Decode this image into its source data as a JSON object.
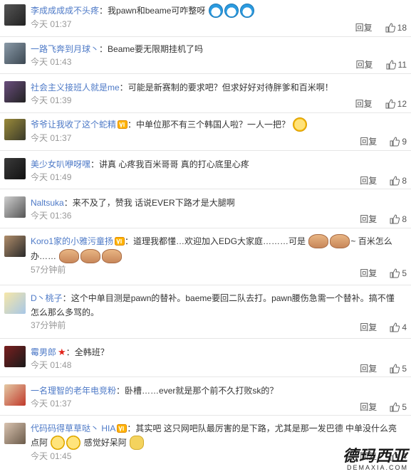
{
  "labels": {
    "reply": "回复"
  },
  "colors": {
    "username": "#4e7ac7",
    "time": "#999999",
    "divider": "#e6e6e6"
  },
  "comments": [
    {
      "user": "李成成成成不头疼",
      "sep": "：",
      "text": "我pawn和beame可咋整呀",
      "time": "今天 01:37",
      "likes": "18",
      "emojis": [
        "doraemon",
        "doraemon",
        "doraemon"
      ]
    },
    {
      "user": "一路飞奔到月球丶",
      "sep": "：",
      "text": "Beame要无限期挂机了吗",
      "time": "今天 01:43",
      "likes": "11"
    },
    {
      "user": "社会主义接班人就是me",
      "sep": "：",
      "text": "可能是新赛制的要求吧？但求好好对待胖爹和百米啊！",
      "time": "今天 01:39",
      "likes": "12"
    },
    {
      "user": "爷爷让我收了这个蛇精",
      "sep": "：",
      "text": "中单位那不有三个韩国人啦？一人一把？",
      "time": "今天 01:37",
      "likes": "9",
      "badge": "vip",
      "emojis": [
        "shock"
      ]
    },
    {
      "user": "美少女叭咿呀嘿",
      "sep": "：",
      "text": "讲真 心疼我百米哥哥 真的打心底里心疼",
      "time": "今天 01:49",
      "likes": "8"
    },
    {
      "user": "Naltsuka",
      "sep": "：",
      "text": "来不及了，赞我 话说EVER下路才是大腿啊",
      "time": "今天 01:36",
      "likes": "8"
    },
    {
      "user": "Koro1家的小雅污童扬",
      "sep": "：",
      "text": "道理我都懂…欢迎加入EDG大家庭………可是",
      "text2": "~ 百米怎么",
      "text3": "办……",
      "time": "57分钟前",
      "likes": "5",
      "badge": "vip"
    },
    {
      "user": "D丶桃子",
      "sep": "：",
      "text": "这个中单目测是pawn的替补。baeme要回二队去打。pawn腰伤急需一个替补。搞不懂怎么那么多骂的。",
      "time": "37分钟前",
      "likes": "4"
    },
    {
      "user": "霉男郎",
      "sep": "：",
      "text": "全韩班？",
      "time": "今天 01:48",
      "likes": "5",
      "badge": "star"
    },
    {
      "user": "一名理智的老年电竞粉",
      "sep": "：",
      "text": "卧槽……ever就是那个前不久打败sk的？",
      "time": "今天 01:37",
      "likes": "5"
    },
    {
      "user": "代码码得草草哒丶 HIA",
      "sep": "：",
      "text": "其实吧 这只网吧队最厉害的是下路，尤其是那一发巴德 中单没什么亮点阿",
      "text2": "感觉好呆阿",
      "time": "今天 01:45",
      "likes": "4",
      "badge": "vip"
    }
  ],
  "watermark": {
    "main": "德玛西亚",
    "sub": "DEMAXIA.COM"
  }
}
